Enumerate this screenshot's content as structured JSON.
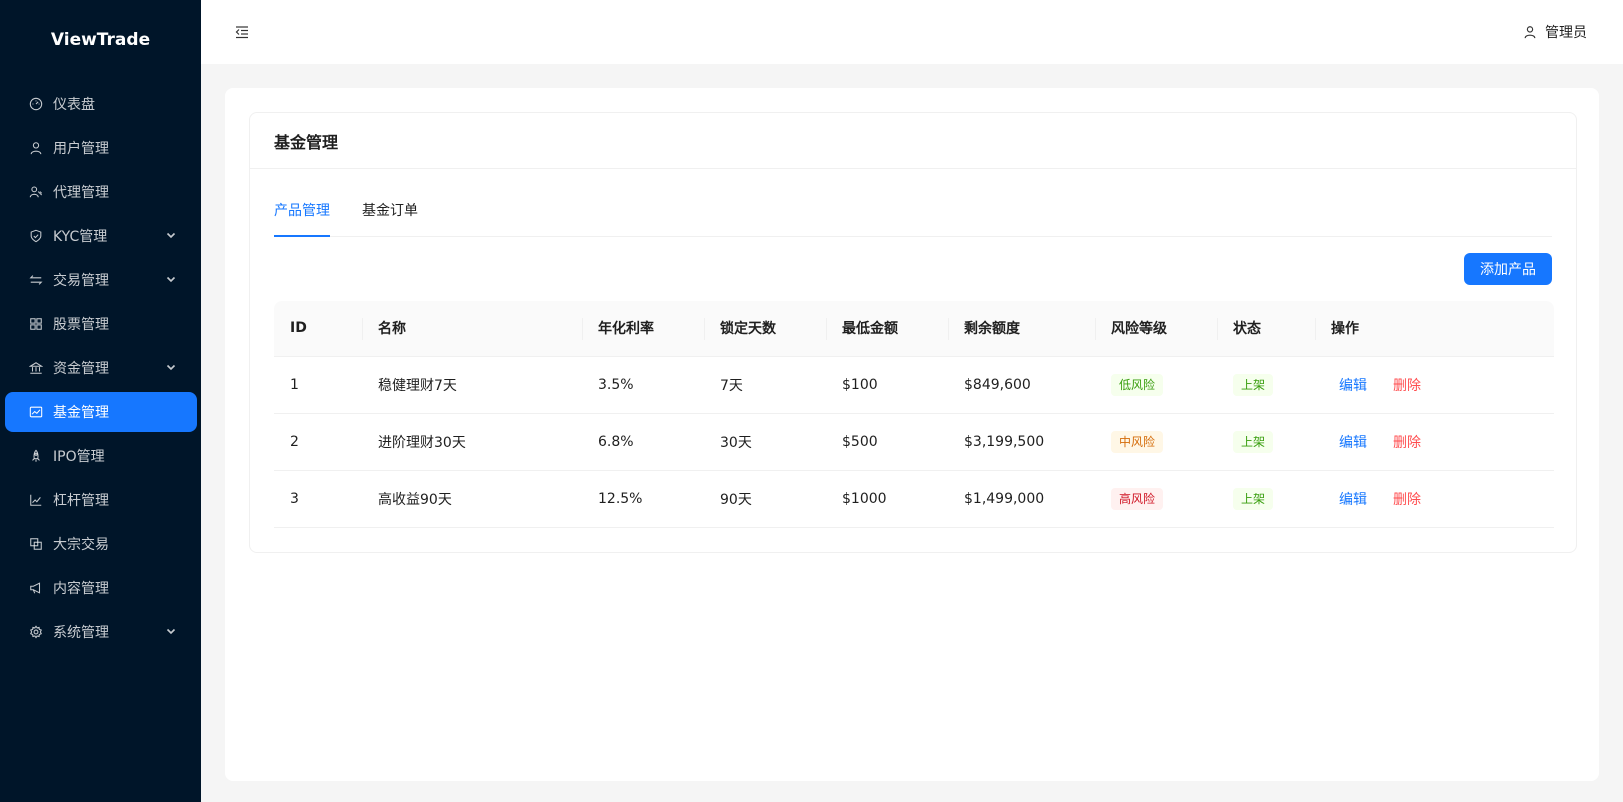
{
  "app": {
    "logo": "ViewTrade"
  },
  "sidebar": {
    "items": [
      {
        "label": "仪表盘",
        "icon": "dashboard-icon",
        "has_arrow": false,
        "active": false
      },
      {
        "label": "用户管理",
        "icon": "user-icon",
        "has_arrow": false,
        "active": false
      },
      {
        "label": "代理管理",
        "icon": "agent-icon",
        "has_arrow": false,
        "active": false
      },
      {
        "label": "KYC管理",
        "icon": "shield-icon",
        "has_arrow": true,
        "active": false
      },
      {
        "label": "交易管理",
        "icon": "swap-icon",
        "has_arrow": true,
        "active": false
      },
      {
        "label": "股票管理",
        "icon": "appstore-icon",
        "has_arrow": false,
        "active": false
      },
      {
        "label": "资金管理",
        "icon": "bank-icon",
        "has_arrow": true,
        "active": false
      },
      {
        "label": "基金管理",
        "icon": "fund-icon",
        "has_arrow": false,
        "active": true
      },
      {
        "label": "IPO管理",
        "icon": "rocket-icon",
        "has_arrow": false,
        "active": false
      },
      {
        "label": "杠杆管理",
        "icon": "line-chart-icon",
        "has_arrow": false,
        "active": false
      },
      {
        "label": "大宗交易",
        "icon": "block-icon",
        "has_arrow": false,
        "active": false
      },
      {
        "label": "内容管理",
        "icon": "notification-icon",
        "has_arrow": false,
        "active": false
      },
      {
        "label": "系统管理",
        "icon": "setting-icon",
        "has_arrow": true,
        "active": false
      }
    ]
  },
  "header": {
    "user": "管理员",
    "collapse_icon": "menu-fold-icon",
    "user_icon": "user-icon"
  },
  "card": {
    "title": "基金管理"
  },
  "tabs": [
    {
      "label": "产品管理",
      "active": true
    },
    {
      "label": "基金订单",
      "active": false
    }
  ],
  "toolbar": {
    "add_label": "添加产品"
  },
  "table": {
    "columns": [
      "ID",
      "名称",
      "年化利率",
      "锁定天数",
      "最低金额",
      "剩余额度",
      "风险等级",
      "状态",
      "操作"
    ],
    "rows": [
      {
        "id": "1",
        "name": "稳健理财7天",
        "rate": "3.5%",
        "days": "7天",
        "min": "$100",
        "remaining": "$849,600",
        "risk": "低风险",
        "risk_level": "low",
        "status": "上架",
        "edit": "编辑",
        "delete": "删除"
      },
      {
        "id": "2",
        "name": "进阶理财30天",
        "rate": "6.8%",
        "days": "30天",
        "min": "$500",
        "remaining": "$3,199,500",
        "risk": "中风险",
        "risk_level": "mid",
        "status": "上架",
        "edit": "编辑",
        "delete": "删除"
      },
      {
        "id": "3",
        "name": "高收益90天",
        "rate": "12.5%",
        "days": "90天",
        "min": "$1000",
        "remaining": "$1,499,000",
        "risk": "高风险",
        "risk_level": "high",
        "status": "上架",
        "edit": "编辑",
        "delete": "删除"
      }
    ]
  },
  "colors": {
    "primary": "#1677ff",
    "sidebar_bg": "#001529",
    "danger": "#ff4d4f"
  }
}
